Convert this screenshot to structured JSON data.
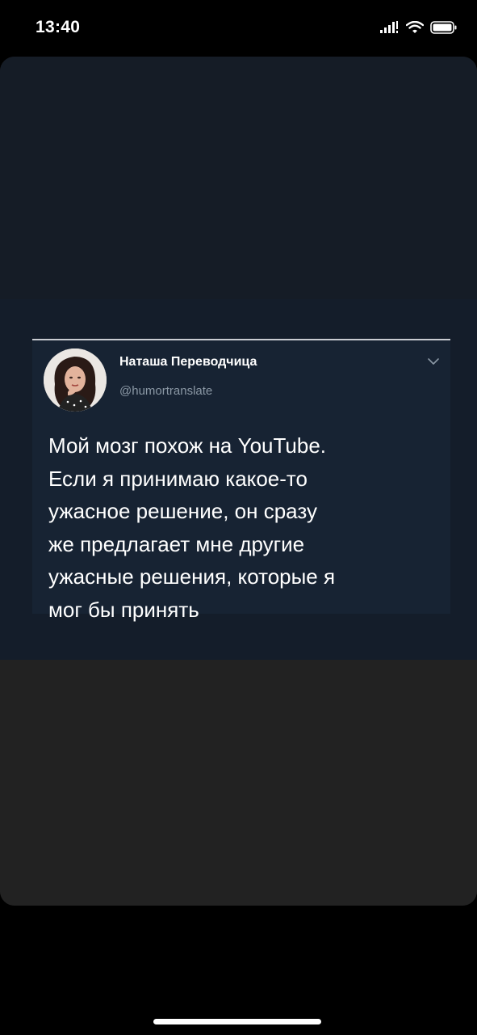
{
  "status_bar": {
    "time": "13:40",
    "icons": [
      "signal-icon",
      "wifi-icon",
      "battery-icon"
    ]
  },
  "tweet": {
    "author_name": "Наташа Переводчица",
    "author_handle": "@humortranslate",
    "text": "Мой мозг похож на YouTube.\nЕсли я принимаю какое-то\nужасное решение, он сразу\nже предлагает мне другие\nужасные решения, которые я\nмог бы принять",
    "menu_icon": "chevron-down-icon"
  },
  "colors": {
    "background": "#000000",
    "card_top": "#151c26",
    "image_bg": "#141d2a",
    "tweet_bg": "#172333",
    "card_bottom": "#222222",
    "text_primary": "#ffffff",
    "text_secondary": "#8b98a5"
  }
}
